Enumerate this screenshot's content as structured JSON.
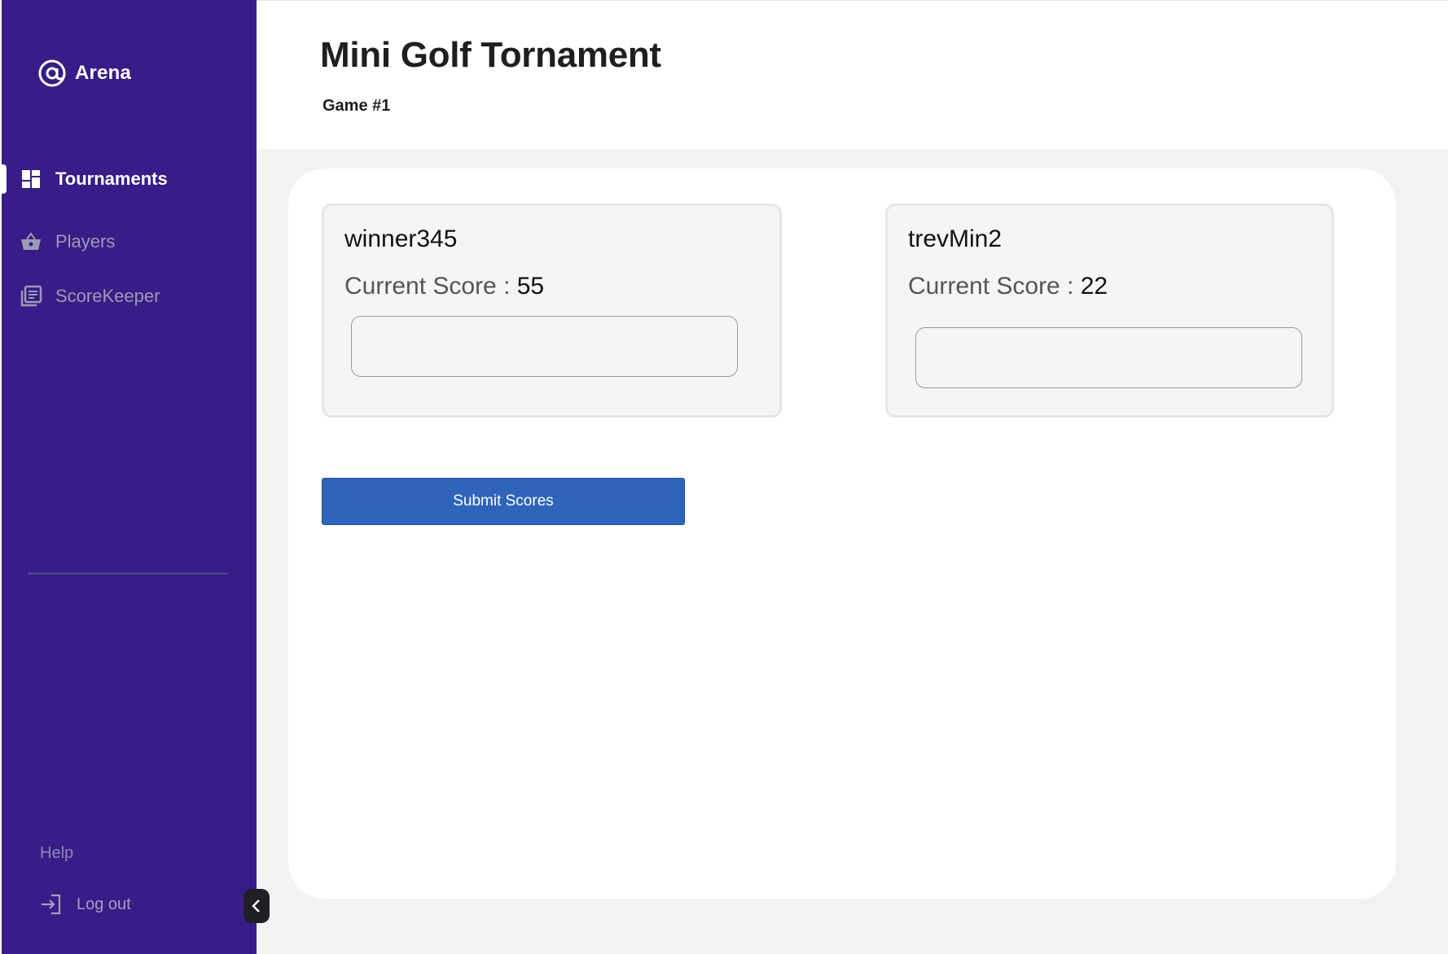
{
  "brand": {
    "name": "Arena",
    "icon": "at-sign-icon"
  },
  "sidebar": {
    "items": [
      {
        "label": "Tournaments",
        "icon": "dashboard-icon",
        "active": true
      },
      {
        "label": "Players",
        "icon": "basket-icon",
        "active": false
      },
      {
        "label": "ScoreKeeper",
        "icon": "library-books-icon",
        "active": false
      }
    ],
    "footer": {
      "help_label": "Help",
      "logout_label": "Log out"
    }
  },
  "header": {
    "title": "Mini Golf Tornament",
    "subtitle": "Game #1"
  },
  "players": [
    {
      "name": "winner345",
      "score_label": "Current Score :",
      "score": "55",
      "input_value": "",
      "input_placeholder": ""
    },
    {
      "name": "trevMin2",
      "score_label": "Current Score :",
      "score": "22",
      "input_value": "",
      "input_placeholder": ""
    }
  ],
  "actions": {
    "submit_label": "Submit Scores"
  },
  "colors": {
    "sidebar_bg": "#381c87",
    "primary_button": "#2f64bb",
    "main_bg": "#f2f2f2",
    "card_bg": "#f5f5f5"
  }
}
